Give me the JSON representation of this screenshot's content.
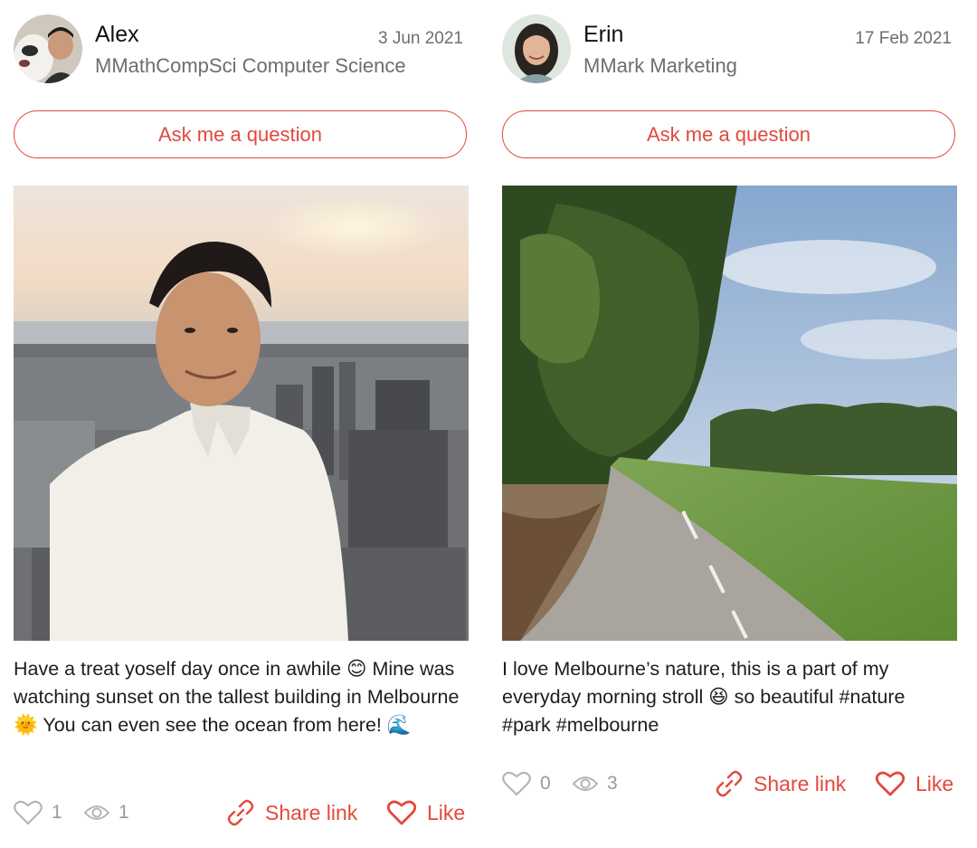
{
  "posts": [
    {
      "author": "Alex",
      "program": "MMathCompSci Computer Science",
      "date": "3 Jun 2021",
      "ask_label": "Ask me a question",
      "caption": "Have a treat yoself day once in awhile 😊 Mine was watching sunset on the tallest building in Melbourne 🌞 You can even see the ocean from here! 🌊",
      "likes": "1",
      "views": "1",
      "share_label": "Share link",
      "like_label": "Like"
    },
    {
      "author": "Erin",
      "program": "MMark Marketing",
      "date": "17 Feb 2021",
      "ask_label": "Ask me a question",
      "caption": "I love Melbourne’s nature, this is a part of my everyday morning stroll 😆 so beautiful #nature #park #melbourne",
      "likes": "0",
      "views": "3",
      "share_label": "Share link",
      "like_label": "Like"
    }
  ],
  "colors": {
    "accent": "#e3493c",
    "muted": "#9a9a9a",
    "subtext": "#6e6e6e"
  },
  "icons": [
    "heart-outline-icon",
    "eye-icon",
    "link-icon",
    "heart-icon"
  ]
}
